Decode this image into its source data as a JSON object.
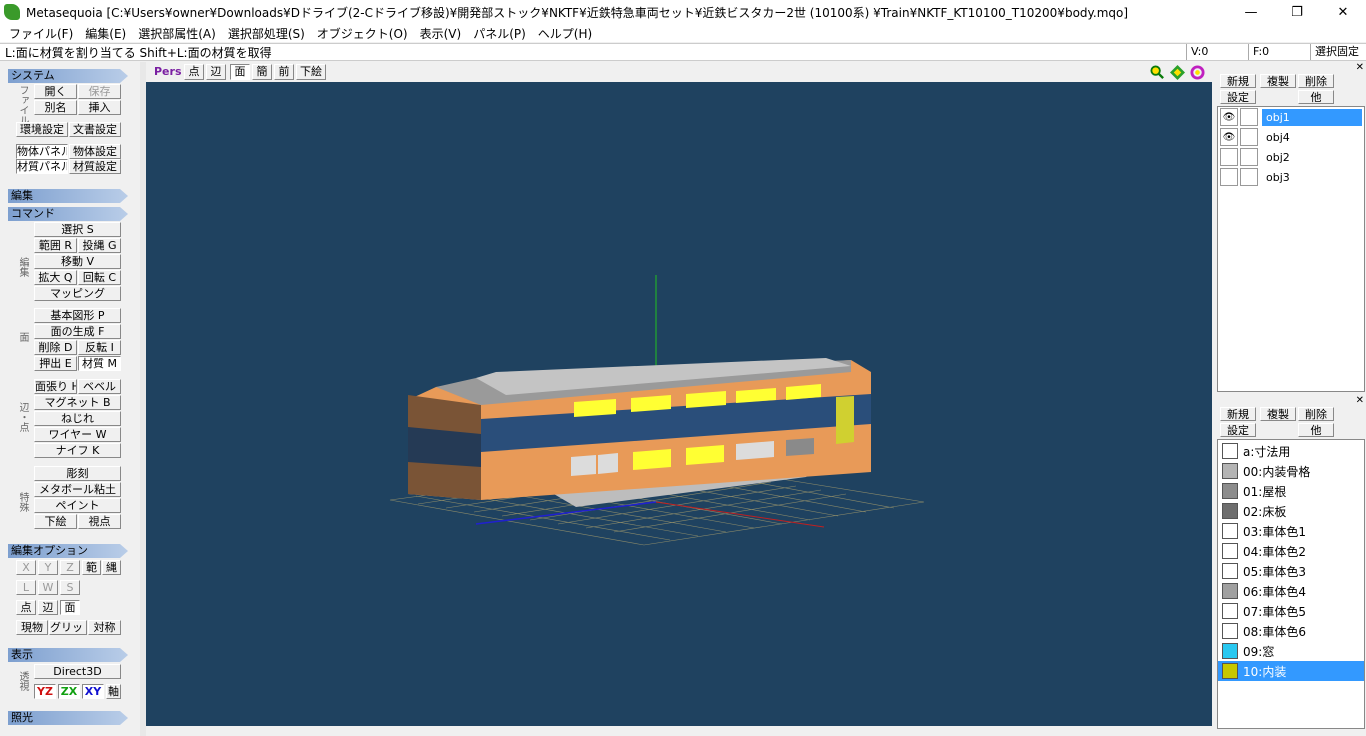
{
  "window": {
    "title": "Metasequoia [C:¥Users¥owner¥Downloads¥Dドライブ(2-Cドライブ移設)¥開発部ストック¥NKTF¥近鉄特急車両セット¥近鉄ビスタカー2世 (10100系) ¥Train¥NKTF_KT10100_T10200¥body.mqo]",
    "minimize": "—",
    "maximize": "❐",
    "close": "✕"
  },
  "menu": [
    "ファイル(F)",
    "編集(E)",
    "選択部属性(A)",
    "選択部処理(S)",
    "オブジェクト(O)",
    "表示(V)",
    "パネル(P)",
    "ヘルプ(H)"
  ],
  "status": {
    "hint": "L:面に材質を割り当てる  Shift+L:面の材質を取得",
    "v": "V:0",
    "f": "F:0",
    "lock": "選択固定"
  },
  "left": {
    "system": {
      "header": "システム",
      "file_label": "ファイル",
      "open": "開く",
      "save": "保存",
      "alias": "別名",
      "insert": "挿入",
      "env": "環境設定",
      "doc": "文書設定",
      "objpanel": "物体パネル",
      "objset": "物体設定",
      "matpanel": "材質パネル",
      "matset": "材質設定"
    },
    "edit": {
      "header": "編集"
    },
    "command": {
      "header": "コマンド",
      "edit_label": "編集",
      "select": "選択 S",
      "range": "範囲 R",
      "lasso": "投縄 G",
      "move": "移動 V",
      "scale": "拡大 Q",
      "rotate": "回転 C",
      "mapping": "マッピング",
      "face_label": "面",
      "primitive": "基本図形 P",
      "genface": "面の生成 F",
      "delete": "削除 D",
      "flip": "反転 I",
      "extrude": "押出 E",
      "material": "材質 M",
      "edgepoint_label": "辺・点",
      "facestretch": "面張り H",
      "bevel": "ベベル",
      "magnet": "マグネット B",
      "twist": "ねじれ",
      "wire": "ワイヤー W",
      "knife": "ナイフ K",
      "special_label": "特殊",
      "sculpt": "彫刻",
      "metaball": "メタボール粘土",
      "paint": "ペイント",
      "underlay": "下絵",
      "viewpoint": "視点"
    },
    "options": {
      "header": "編集オプション",
      "x": "X",
      "y": "Y",
      "z": "Z",
      "range": "範",
      "lasso": "縄",
      "l": "L",
      "w": "W",
      "s": "S",
      "point": "点",
      "edge": "辺",
      "face": "面",
      "current": "現物",
      "grid": "グリッド",
      "sym": "対称"
    },
    "display": {
      "header": "表示",
      "persp_label": "透視",
      "d3d": "Direct3D",
      "yz": "YZ",
      "zx": "ZX",
      "xy": "XY",
      "axis": "軸"
    },
    "lighting": {
      "header": "照光"
    }
  },
  "viewport": {
    "mode": "Pers",
    "point": "点",
    "edge": "辺",
    "face": "面",
    "simple": "簡",
    "front": "前",
    "underlay": "下絵",
    "icons": [
      "zoom-icon",
      "pan-icon",
      "rotate-icon"
    ]
  },
  "objects": {
    "new": "新規",
    "copy": "複製",
    "delete": "削除",
    "settings": "設定",
    "other": "他",
    "items": [
      {
        "name": "obj1",
        "visible": true,
        "selected": true
      },
      {
        "name": "obj4",
        "visible": true,
        "selected": false
      },
      {
        "name": "obj2",
        "visible": false,
        "selected": false
      },
      {
        "name": "obj3",
        "visible": false,
        "selected": false
      }
    ]
  },
  "materials": {
    "new": "新規",
    "copy": "複製",
    "delete": "削除",
    "settings": "設定",
    "other": "他",
    "items": [
      {
        "name": "a:寸法用",
        "color": "#ffffff"
      },
      {
        "name": "00:内装骨格",
        "color": "#b4b4b4"
      },
      {
        "name": "01:屋根",
        "color": "#8c8c8c"
      },
      {
        "name": "02:床板",
        "color": "#6e6e6e"
      },
      {
        "name": "03:車体色1",
        "color": "#ffffff"
      },
      {
        "name": "04:車体色2",
        "color": "#ffffff"
      },
      {
        "name": "05:車体色3",
        "color": "#ffffff"
      },
      {
        "name": "06:車体色4",
        "color": "#a0a0a0"
      },
      {
        "name": "07:車体色5",
        "color": "#ffffff"
      },
      {
        "name": "08:車体色6",
        "color": "#ffffff"
      },
      {
        "name": "09:窓",
        "color": "#29c8f0"
      },
      {
        "name": "10:内装",
        "color": "#c8c800",
        "selected": true
      }
    ]
  }
}
